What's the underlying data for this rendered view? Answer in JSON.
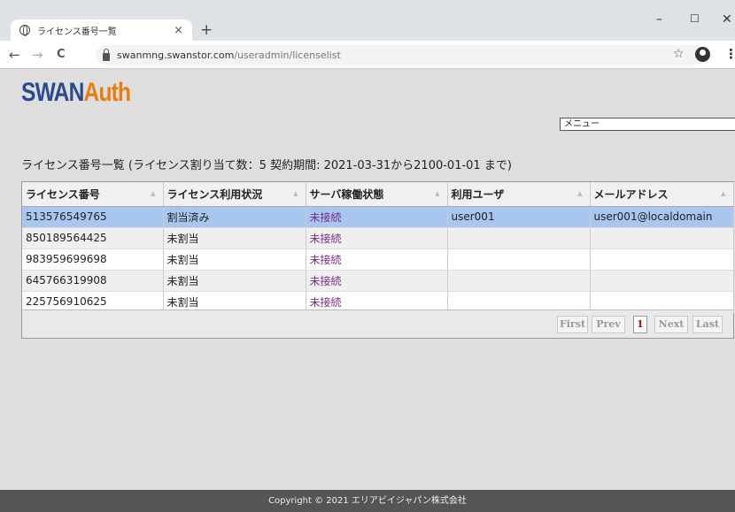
{
  "browser": {
    "tab_title": "ライセンス番号一覧",
    "tab_close": "×",
    "new_tab": "+",
    "minimize": "–",
    "maximize": "☐",
    "close": "✕",
    "back": "←",
    "forward": "→",
    "reload": "C",
    "url_host": "swanmng.swanstor.com",
    "url_path": "/useradmin/licenselist",
    "star": "☆",
    "menu": "⋮"
  },
  "logo": {
    "part1": "SWAN",
    "part2": "Auth"
  },
  "menu_select": "メニュー",
  "heading": "ライセンス番号一覧 (ライセンス割り当て数：5 契約期間: 2021-03-31から2100-01-01 まで)",
  "table": {
    "columns": [
      "ライセンス番号",
      "ライセンス利用状況",
      "サーバ稼働状態",
      "利用ユーザ",
      "メールアドレス"
    ],
    "rows": [
      [
        "513576549765",
        "割当済み",
        "未接続",
        "user001",
        "user001@localdomain"
      ],
      [
        "850189564425",
        "未割当",
        "未接続",
        "",
        ""
      ],
      [
        "983959699698",
        "未割当",
        "未接続",
        "",
        ""
      ],
      [
        "645766319908",
        "未割当",
        "未接続",
        "",
        ""
      ],
      [
        "225756910625",
        "未割当",
        "未接続",
        "",
        ""
      ]
    ]
  },
  "pager": {
    "first": "First",
    "prev": "Prev",
    "current": "1",
    "next": "Next",
    "last": "Last"
  },
  "footer": "Copyright © 2021 エリアビイジャパン株式会社"
}
